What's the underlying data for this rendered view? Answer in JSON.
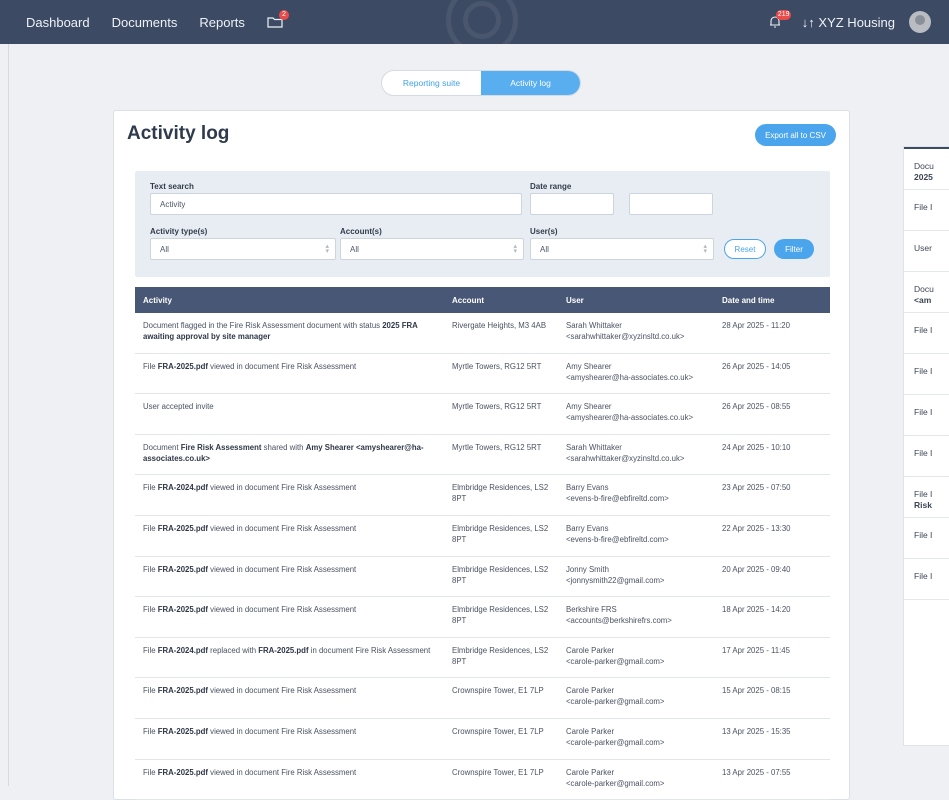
{
  "nav": {
    "items": [
      "Dashboard",
      "Documents",
      "Reports"
    ],
    "folder_badge": "2",
    "notification_badge": "219",
    "org_switch": "↓↑ XYZ Housing"
  },
  "tabs": [
    "Reporting suite",
    "Activity log"
  ],
  "card": {
    "title": "Activity log",
    "export_label": "Export all to CSV"
  },
  "filters": {
    "text_search_label": "Text search",
    "text_search_value": "Activity",
    "date_range_label": "Date range",
    "activity_types_label": "Activity type(s)",
    "activity_types_value": "All",
    "accounts_label": "Account(s)",
    "accounts_value": "All",
    "users_label": "User(s)",
    "users_value": "All",
    "reset_label": "Reset",
    "filter_label": "Filter"
  },
  "table": {
    "columns": [
      "Activity",
      "Account",
      "User",
      "Date and time"
    ],
    "rows": [
      {
        "pre": "Document flagged in the Fire Risk Assessment document with status ",
        "bold": "2025 FRA awaiting approval by site manager",
        "mid": "",
        "bold2": "",
        "post": "",
        "account": "Rivergate Heights, M3 4AB",
        "user": "Sarah Whittaker",
        "email": "<sarahwhittaker@xyzinsltd.co.uk>",
        "date": "28 Apr 2025 - 11:20"
      },
      {
        "pre": "File ",
        "bold": "FRA-2025.pdf",
        "mid": " viewed in document Fire Risk Assessment",
        "bold2": "",
        "post": "",
        "account": "Myrtle Towers, RG12 5RT",
        "user": "Amy Shearer",
        "email": "<amyshearer@ha-associates.co.uk>",
        "date": "26 Apr 2025 - 14:05"
      },
      {
        "pre": "User accepted invite",
        "bold": "",
        "mid": "",
        "bold2": "",
        "post": "",
        "account": "Myrtle Towers, RG12 5RT",
        "user": "Amy Shearer",
        "email": "<amyshearer@ha-associates.co.uk>",
        "date": "26 Apr 2025 - 08:55"
      },
      {
        "pre": "Document ",
        "bold": "Fire Risk Assessment",
        "mid": " shared with ",
        "bold2": "Amy Shearer <amyshearer@ha-associates.co.uk>",
        "post": "",
        "account": "Myrtle Towers, RG12 5RT",
        "user": "Sarah Whittaker",
        "email": "<sarahwhittaker@xyzinsltd.co.uk>",
        "date": "24 Apr 2025 - 10:10"
      },
      {
        "pre": "File ",
        "bold": "FRA-2024.pdf",
        "mid": " viewed in document Fire Risk Assessment",
        "bold2": "",
        "post": "",
        "account": "Elmbridge Residences, LS2 8PT",
        "user": "Barry Evans",
        "email": "<evens-b-fire@ebfireltd.com>",
        "date": "23 Apr 2025 - 07:50"
      },
      {
        "pre": "File ",
        "bold": "FRA-2025.pdf",
        "mid": " viewed in document Fire Risk Assessment",
        "bold2": "",
        "post": "",
        "account": "Elmbridge Residences, LS2 8PT",
        "user": "Barry Evans",
        "email": "<evens-b-fire@ebfireltd.com>",
        "date": "22 Apr 2025 - 13:30"
      },
      {
        "pre": "File ",
        "bold": "FRA-2025.pdf",
        "mid": " viewed in document Fire Risk Assessment",
        "bold2": "",
        "post": "",
        "account": "Elmbridge Residences, LS2 8PT",
        "user": "Jonny Smith",
        "email": "<jonnysmith22@gmail.com>",
        "date": "20 Apr 2025 - 09:40"
      },
      {
        "pre": "File ",
        "bold": "FRA-2025.pdf",
        "mid": " viewed in document Fire Risk Assessment",
        "bold2": "",
        "post": "",
        "account": "Elmbridge Residences, LS2 8PT",
        "user": "Berkshire FRS",
        "email": "<accounts@berkshirefrs.com>",
        "date": "18 Apr 2025 - 14:20"
      },
      {
        "pre": "File ",
        "bold": "FRA-2024.pdf",
        "mid": " replaced with ",
        "bold2": "FRA-2025.pdf",
        "post": " in document Fire Risk Assessment",
        "account": "Elmbridge Residences, LS2 8PT",
        "user": "Carole Parker",
        "email": "<carole-parker@gmail.com>",
        "date": "17 Apr 2025 - 11:45"
      },
      {
        "pre": "File ",
        "bold": "FRA-2025.pdf",
        "mid": " viewed in document Fire Risk Assessment",
        "bold2": "",
        "post": "",
        "account": "Crownspire Tower, E1 7LP",
        "user": "Carole Parker",
        "email": "<carole-parker@gmail.com>",
        "date": "15 Apr 2025 - 08:15"
      },
      {
        "pre": "File ",
        "bold": "FRA-2025.pdf",
        "mid": " viewed in document Fire Risk Assessment",
        "bold2": "",
        "post": "",
        "account": "Crownspire Tower, E1 7LP",
        "user": "Carole Parker",
        "email": "<carole-parker@gmail.com>",
        "date": "13 Apr 2025 - 15:35"
      },
      {
        "pre": "File ",
        "bold": "FRA-2025.pdf",
        "mid": " viewed in document Fire Risk Assessment",
        "bold2": "",
        "post": "",
        "account": "Crownspire Tower, E1 7LP",
        "user": "Carole Parker",
        "email": "<carole-parker@gmail.com>",
        "date": "13 Apr 2025 - 07:55"
      }
    ]
  },
  "side_panel": {
    "items": [
      {
        "line1": "Docu",
        "line2": "2025"
      },
      {
        "line1": "File I",
        "line2": ""
      },
      {
        "line1": "User",
        "line2": ""
      },
      {
        "line1": "Docu",
        "line2": "<am"
      },
      {
        "line1": "File I",
        "line2": ""
      },
      {
        "line1": "File I",
        "line2": ""
      },
      {
        "line1": "File I",
        "line2": ""
      },
      {
        "line1": "File I",
        "line2": ""
      },
      {
        "line1": "File I",
        "line2": "Risk"
      },
      {
        "line1": "File I",
        "line2": ""
      },
      {
        "line1": "File I",
        "line2": ""
      }
    ]
  }
}
